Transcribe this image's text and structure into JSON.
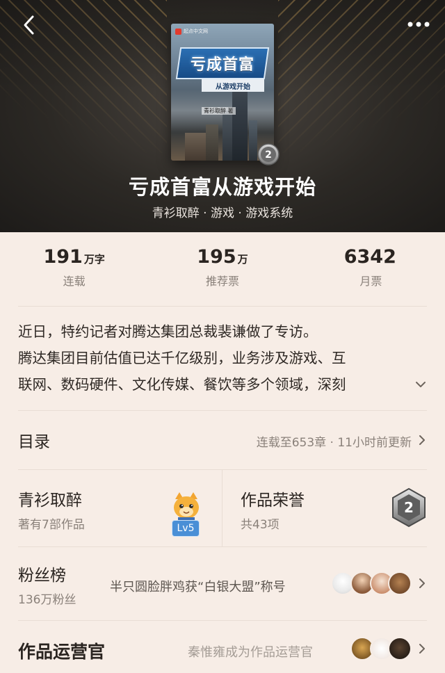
{
  "header": {
    "cover": {
      "publisher": "起点中文网",
      "title_text": "亏成首富",
      "subtitle_text": "从游戏开始",
      "author_text": "青衫取醉 著"
    },
    "cover_badge_text": "2",
    "title": "亏成首富从游戏开始",
    "meta": "青衫取醉 · 游戏 · 游戏系统"
  },
  "stats": [
    {
      "value": "191",
      "unit": "万字",
      "label": "连载"
    },
    {
      "value": "195",
      "unit": "万",
      "label": "推荐票"
    },
    {
      "value": "6342",
      "unit": "",
      "label": "月票"
    }
  ],
  "synopsis": {
    "lines": [
      "近日，特约记者对腾达集团总裁裴谦做了专访。",
      "腾达集团目前估值已达千亿级别，业务涉及游戏、互",
      "联网、数码硬件、文化传媒、餐饮等多个领域，深刻"
    ]
  },
  "toc": {
    "title": "目录",
    "status": "连载至653章 · 11小时前更新"
  },
  "author": {
    "name": "青衫取醉",
    "works": "著有7部作品",
    "level": "Lv5"
  },
  "honor": {
    "title": "作品荣誉",
    "count": "共43项",
    "medal_text": "2"
  },
  "fans": {
    "title": "粉丝榜",
    "count": "136万粉丝",
    "note": "半只圆脸胖鸡获“白银大盟”称号"
  },
  "operator": {
    "title": "作品运营官",
    "note": "秦惟雍成为作品运营官"
  },
  "colors": {
    "page_bg": "#f7ede6",
    "header_dark": "#2c2925",
    "gold_stripe": "#c9a05a",
    "text_primary": "#2a2420",
    "text_secondary": "#8a817a",
    "level_badge": "#4a8fd6"
  }
}
